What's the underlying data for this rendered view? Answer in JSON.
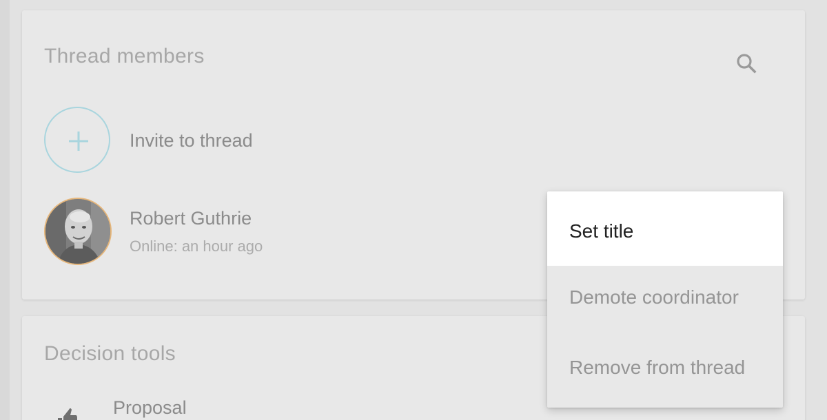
{
  "members_card": {
    "title": "Thread members",
    "search_icon": "search-icon",
    "invite": {
      "label": "Invite to thread",
      "icon": "plus-icon",
      "accent": "#a9d5de"
    },
    "members": [
      {
        "name": "Robert Guthrie",
        "status": "Online: an hour ago",
        "avatar_border": "#e6b67a"
      }
    ]
  },
  "decision_card": {
    "title": "Decision tools",
    "tools": [
      {
        "label": "Proposal",
        "icon": "thumbs-up-icon"
      }
    ]
  },
  "context_menu": {
    "items": [
      {
        "label": "Set title",
        "highlighted": true
      },
      {
        "label": "Demote coordinator",
        "highlighted": false
      },
      {
        "label": "Remove from thread",
        "highlighted": false
      }
    ]
  }
}
